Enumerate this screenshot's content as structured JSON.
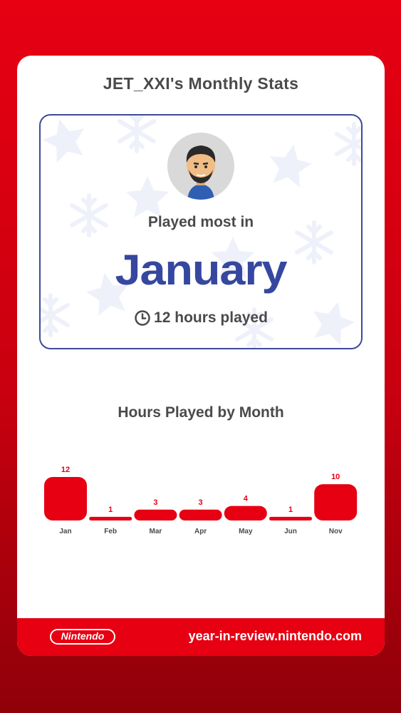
{
  "card": {
    "title": "JET_XXI's Monthly Stats"
  },
  "hero": {
    "label": "Played most in",
    "month": "January",
    "hours_text": "12 hours played",
    "clock_icon": "clock-icon",
    "avatar_icon": "mii-avatar"
  },
  "chart_title": "Hours Played by Month",
  "chart_data": {
    "type": "bar",
    "categories": [
      "Jan",
      "Feb",
      "Mar",
      "Apr",
      "May",
      "Jun",
      "Nov"
    ],
    "values": [
      12,
      1,
      3,
      3,
      4,
      1,
      10
    ],
    "title": "Hours Played by Month",
    "xlabel": "",
    "ylabel": "",
    "grid": false,
    "color": "#e60012"
  },
  "footer": {
    "logo": "Nintendo",
    "url": "year-in-review.nintendo.com"
  },
  "colors": {
    "brand_red": "#e60012",
    "accent_blue": "#36479f"
  }
}
